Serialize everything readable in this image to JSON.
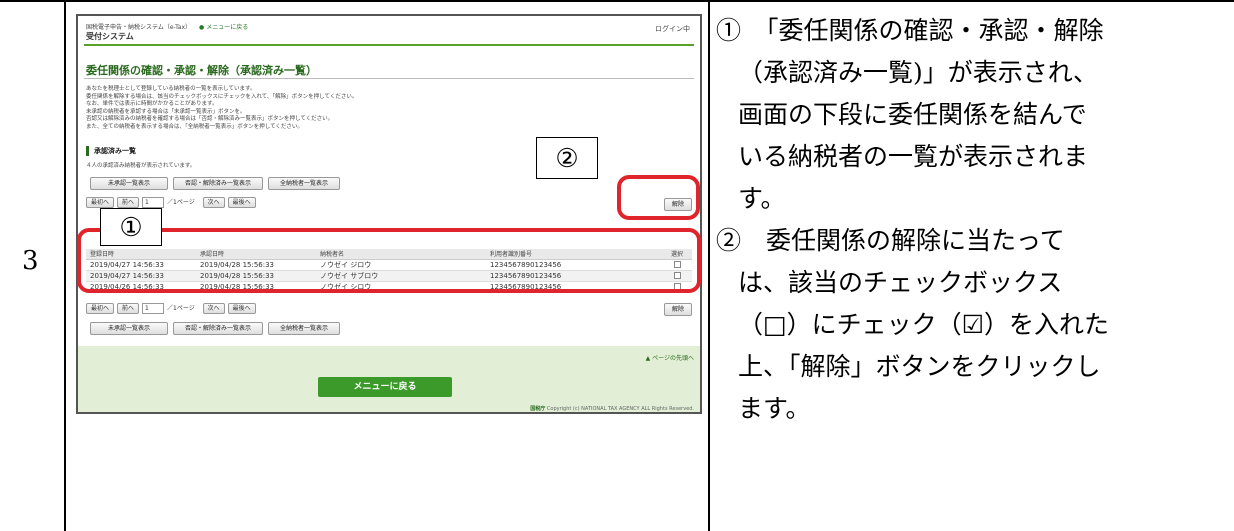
{
  "step_number": "3",
  "screenshot": {
    "breadcrumb": "国税電子申告・納税システム（e-Tax）",
    "menu_link": "メニューに戻る",
    "login_status": "ログイン中",
    "system_title": "受付システム",
    "page_heading": "委任関係の確認・承認・解除（承認済み一覧）",
    "description": [
      "あなたを税理士として登録している納税者の一覧を表示しています。",
      "委任関係を解除する場合は、該当のチェックボックスにチェックを入れて、「解除」ボタンを押してください。",
      "なお、単件では表示に時間がかかることがあります。",
      "未承認の納税者を承認する場合は「未承認一覧表示」ボタンを。",
      "否認又は解除済みの納税者を確認する場合は「否認・解除済み一覧表示」ボタンを押してください。",
      "また、全ての納税者を表示する場合は、「全納税者一覧表示」ボタンを押してください。"
    ],
    "section_title": "承認済み一覧",
    "count_text": "４人の承認済み納税者が表示されています。",
    "filter_buttons": [
      "未承認一覧表示",
      "否認・解除済み一覧表示",
      "全納税者一覧表示"
    ],
    "pager": {
      "first": "最初へ",
      "prev": "前へ",
      "page_select": "1",
      "page_text": "／1ページ",
      "next": "次へ",
      "last": "最後へ"
    },
    "release_button": "解除",
    "table": {
      "headers": [
        "登録日時",
        "承認日時",
        "納税者名",
        "利用者識別番号",
        "選択"
      ],
      "rows": [
        [
          "2019/04/27 14:56:33",
          "2019/04/28 15:56:33",
          "ノウゼイ ジロウ",
          "1234567890123456"
        ],
        [
          "2019/04/27 14:56:33",
          "2019/04/28 15:56:33",
          "ノウゼイ サブロウ",
          "1234567890123456"
        ],
        [
          "2019/04/26 14:56:33",
          "2019/04/28 15:56:33",
          "ノウゼイ シロウ",
          "1234567890123456"
        ]
      ]
    },
    "page_top": "ページの先頭へ",
    "menu_back": "メニューに戻る",
    "copyright_org": "国税庁",
    "copyright": "Copyright (c) NATIONAL TAX AGENCY ALL Rights Reserved."
  },
  "callouts": [
    "①",
    "②"
  ],
  "instructions": [
    "①　「委任関係の確認・承認・解除",
    "（承認済み一覧)」が表示され、",
    "画面の下段に委任関係を結んで",
    "いる納税者の一覧が表示されま",
    "す。",
    "②　委任関係の解除に当たって",
    "は、該当のチェックボックス",
    "（□）にチェック（☑）を入れた",
    "上、「解除」ボタンをクリックし",
    "ます。"
  ],
  "colors": {
    "annotation_red": "#e0242b",
    "accent_green": "#3b9a2a"
  }
}
